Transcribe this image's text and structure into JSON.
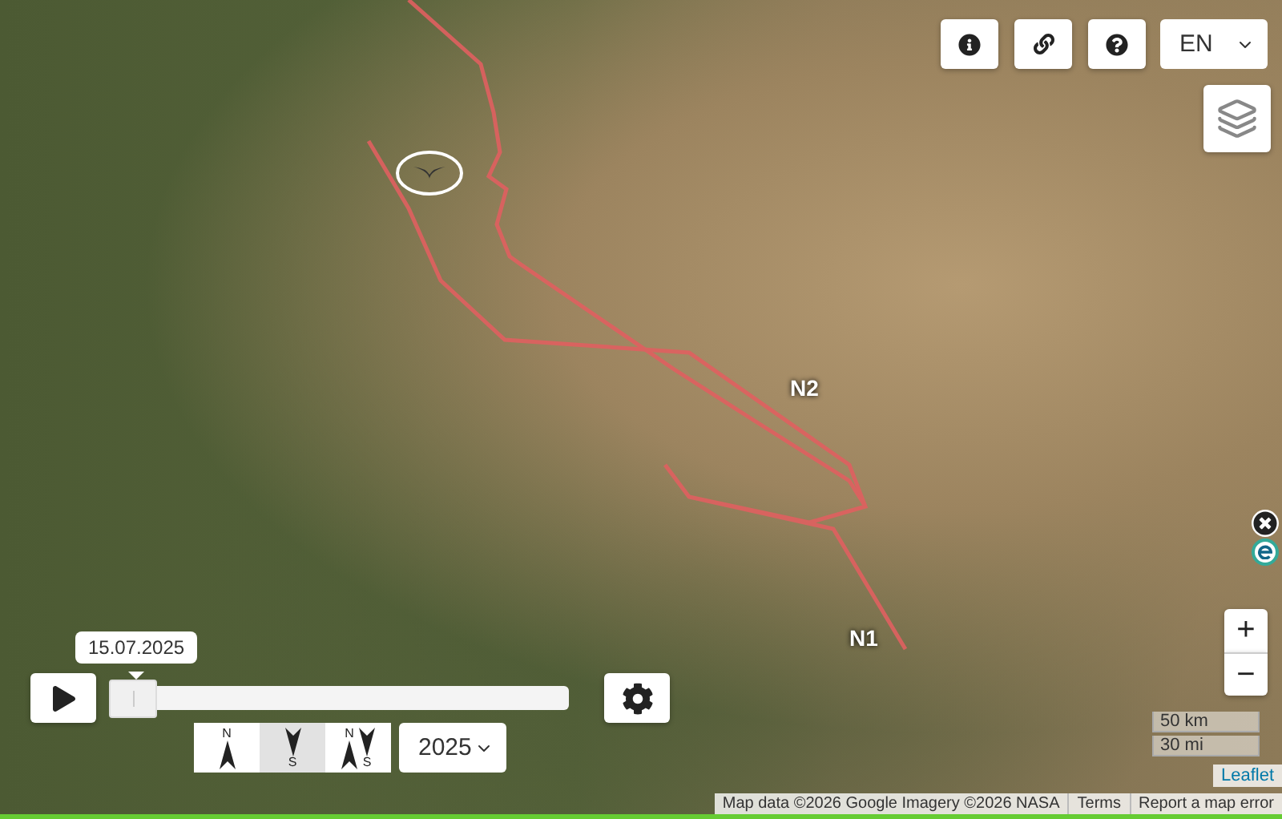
{
  "top_controls": {
    "language": "EN"
  },
  "route_labels": [
    {
      "text": "N2"
    },
    {
      "text": "N1"
    }
  ],
  "timeline": {
    "date": "15.07.2025",
    "level": 0.0
  },
  "direction_buttons": [
    {
      "kind": "north",
      "selected": false,
      "letters": [
        "N"
      ]
    },
    {
      "kind": "south",
      "selected": true,
      "letters": [
        "S"
      ]
    },
    {
      "kind": "both",
      "selected": false,
      "letters": [
        "N",
        "S"
      ]
    }
  ],
  "year": "2025",
  "zoom": {
    "in": "+",
    "out": "−"
  },
  "scale": {
    "metric": "50 km",
    "imperial": "30 mi"
  },
  "attribution": {
    "leaflet": "Leaflet",
    "links": [
      "Map data ©2026 Google Imagery ©2026 NASA",
      "Terms",
      "Report a map error"
    ]
  }
}
